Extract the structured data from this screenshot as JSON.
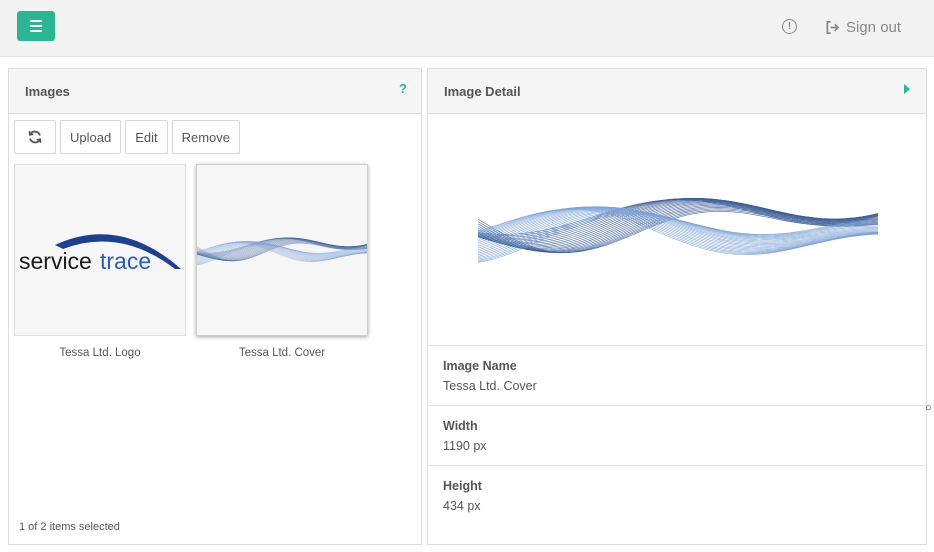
{
  "header": {
    "menu_icon": "hamburger-menu-icon",
    "info_icon": "info-circle-icon",
    "info_glyph": "!",
    "signout_label": "Sign out",
    "accent_color": "#2bb592"
  },
  "images_panel": {
    "title": "Images",
    "help_glyph": "?",
    "toolbar": {
      "refresh_icon": "refresh-icon",
      "upload_label": "Upload",
      "edit_label": "Edit",
      "remove_label": "Remove"
    },
    "items": [
      {
        "caption": "Tessa Ltd. Logo",
        "logo_text_a": "service",
        "logo_text_b": "trace",
        "selected": false
      },
      {
        "caption": "Tessa Ltd. Cover",
        "selected": true
      }
    ],
    "status": "1 of 2 items selected"
  },
  "detail_panel": {
    "title": "Image Detail",
    "properties": [
      {
        "label": "Image Name",
        "value": "Tessa Ltd. Cover"
      },
      {
        "label": "Width",
        "value": "1190 px"
      },
      {
        "label": "Height",
        "value": "434 px"
      }
    ]
  }
}
